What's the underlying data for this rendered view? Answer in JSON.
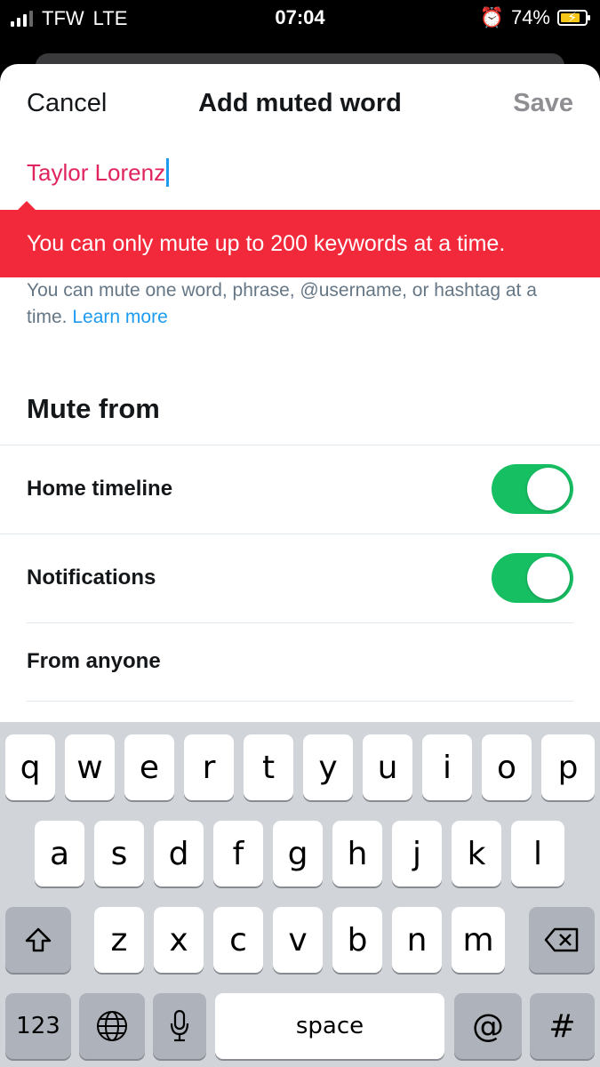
{
  "status_bar": {
    "carrier": "TFW",
    "network": "LTE",
    "time": "07:04",
    "battery_percent": "74%",
    "alarm_icon": "alarm-clock-icon"
  },
  "nav": {
    "cancel_label": "Cancel",
    "title": "Add muted word",
    "save_label": "Save"
  },
  "input": {
    "value": "Taylor Lorenz"
  },
  "error_message": "You can only mute up to 200 keywords at a time.",
  "helper": {
    "text": "You can mute one word, phrase, @username, or hashtag at a time.",
    "link": "Learn more"
  },
  "mute_from": {
    "title": "Mute from",
    "rows": [
      {
        "label": "Home timeline",
        "toggle_on": true
      },
      {
        "label": "Notifications",
        "toggle_on": true
      },
      {
        "label": "From anyone"
      }
    ]
  },
  "colors": {
    "error": "#f1293a",
    "toggle_on": "#17bf63",
    "link": "#1d9bf0",
    "input_text": "#e0245e"
  },
  "keyboard": {
    "row1": [
      "q",
      "w",
      "e",
      "r",
      "t",
      "y",
      "u",
      "i",
      "o",
      "p"
    ],
    "row2": [
      "a",
      "s",
      "d",
      "f",
      "g",
      "h",
      "j",
      "k",
      "l"
    ],
    "row3": [
      "z",
      "x",
      "c",
      "v",
      "b",
      "n",
      "m"
    ],
    "numbers_key": "123",
    "space_key": "space",
    "at_key": "@",
    "hash_key": "#"
  }
}
